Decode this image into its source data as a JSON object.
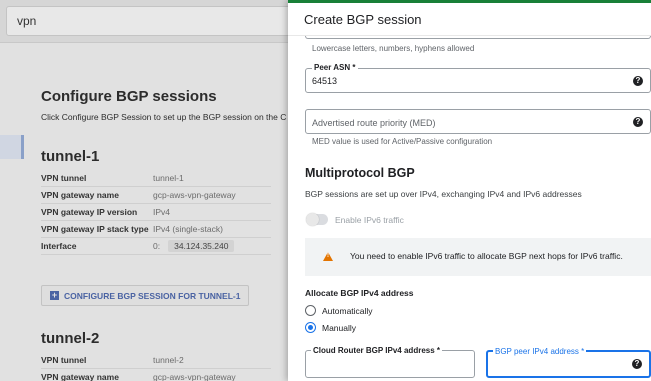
{
  "background": {
    "search_value": "vpn",
    "heading": "Configure BGP sessions",
    "description": "Click Configure BGP Session to set up the BGP session on the C",
    "tunnel1": {
      "name": "tunnel-1",
      "rows": [
        {
          "key": "VPN tunnel",
          "value": "tunnel-1"
        },
        {
          "key": "VPN gateway name",
          "value": "gcp-aws-vpn-gateway"
        },
        {
          "key": "VPN gateway IP version",
          "value": "IPv4"
        },
        {
          "key": "VPN gateway IP stack type",
          "value": "IPv4 (single-stack)"
        },
        {
          "key": "Interface",
          "value": "0:",
          "chip": "34.124.35.240"
        }
      ],
      "button_label": "CONFIGURE BGP SESSION FOR TUNNEL-1"
    },
    "tunnel2": {
      "name": "tunnel-2",
      "rows": [
        {
          "key": "VPN tunnel",
          "value": "tunnel-2"
        },
        {
          "key": "VPN gateway name",
          "value": "gcp-aws-vpn-gateway"
        }
      ]
    }
  },
  "panel": {
    "title": "Create BGP session",
    "name_helper": "Lowercase letters, numbers, hyphens allowed",
    "peer_asn": {
      "label": "Peer ASN *",
      "value": "64513"
    },
    "med": {
      "placeholder": "Advertised route priority (MED)",
      "helper": "MED value is used for Active/Passive configuration"
    },
    "multiprotocol": {
      "title": "Multiprotocol BGP",
      "description": "BGP sessions are set up over IPv4, exchanging IPv4 and IPv6 addresses",
      "toggle_label": "Enable IPv6 traffic",
      "toggle_on": false
    },
    "warning": "You need to enable IPv6 traffic to allocate BGP next hops for IPv6 traffic.",
    "allocate": {
      "title": "Allocate BGP IPv4 address",
      "options": [
        "Automatically",
        "Manually"
      ],
      "selected": "Manually"
    },
    "cloud_router_ip_label": "Cloud Router BGP IPv4 address *",
    "peer_ip_label": "BGP peer IPv4 address *",
    "icons": {
      "help": "help-circle-icon",
      "warning": "warning-triangle-icon",
      "add": "add-box-icon"
    },
    "colors": {
      "accent": "#1a73e8",
      "warning": "#e37400",
      "success_strip": "#188038"
    }
  }
}
